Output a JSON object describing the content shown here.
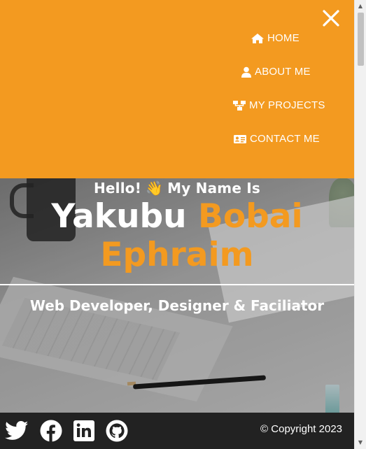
{
  "nav": {
    "close_icon": "close-icon",
    "items": [
      {
        "label": "HOME",
        "icon": "home-icon"
      },
      {
        "label": "ABOUT ME",
        "icon": "user-icon"
      },
      {
        "label": "MY PROJECTS",
        "icon": "sitemap-icon"
      },
      {
        "label": "CONTACT ME",
        "icon": "id-card-icon"
      }
    ]
  },
  "hero": {
    "greeting_before": "Hello!",
    "wave_emoji": "👋",
    "greeting_after": "My Name Is",
    "first_name": "Yakubu",
    "middle_name": "Bobai",
    "last_name": "Ephraim",
    "tagline": "Web Developer, Designer & Faciliator"
  },
  "footer": {
    "social": [
      "twitter-icon",
      "facebook-icon",
      "linkedin-icon",
      "github-icon"
    ],
    "copyright": "© Copyright 2023"
  },
  "colors": {
    "accent": "#f39a20",
    "footer_bg": "#222222",
    "text_light": "#ffffff"
  }
}
